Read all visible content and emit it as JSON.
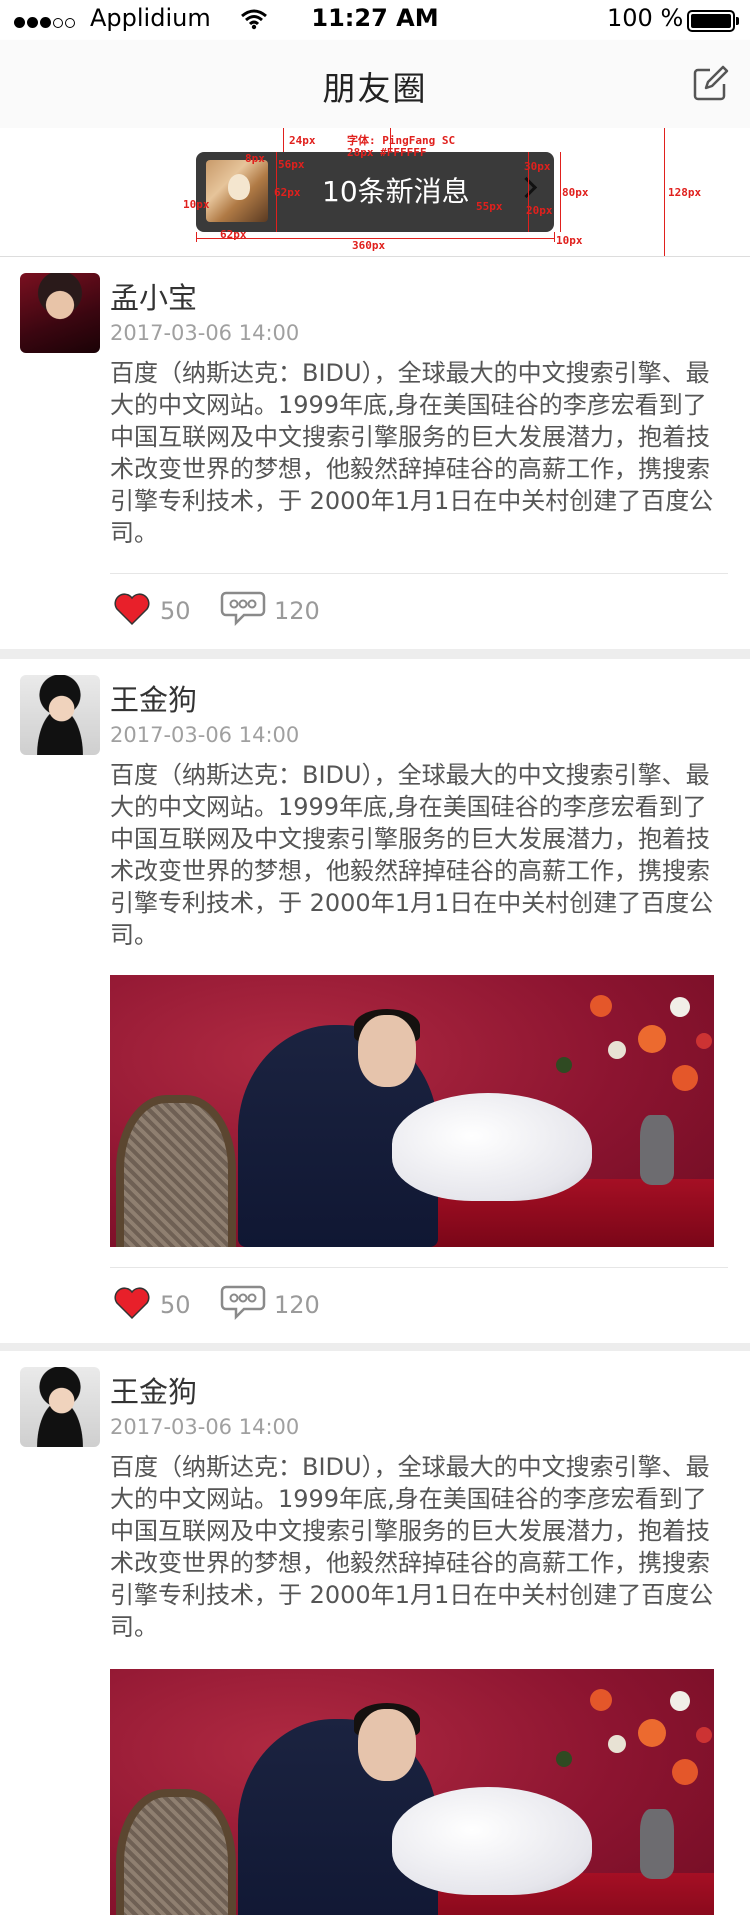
{
  "status_bar": {
    "carrier": "Applidium",
    "time": "11:27 AM",
    "battery": "100 %"
  },
  "nav": {
    "title": "朋友圈"
  },
  "notification": {
    "message": "10条新消息"
  },
  "spec_annotations": {
    "a24": "24px",
    "font": "字体: PingFang SC",
    "font2": "28px #FFFFFF",
    "a8": "8px",
    "a56": "56px",
    "a62h": "62px",
    "a10l": "10px",
    "a30": "30px",
    "a80": "80px",
    "a20": "20px",
    "a55": "55px",
    "a62w": "62px",
    "a360": "360px",
    "a10r": "10px",
    "a128": "128px"
  },
  "posts": [
    {
      "name": "孟小宝",
      "date": "2017-03-06 14:00",
      "content": "百度（纳斯达克：BIDU），全球最大的中文搜索引擎、最大的中文网站。1999年底,身在美国硅谷的李彦宏看到了中国互联网及中文搜索引擎服务的巨大发展潜力，抱着技术改变世界的梦想，他毅然辞掉硅谷的高薪工作，携搜索引擎专利技术，于 2000年1月1日在中关村创建了百度公司。",
      "likes": "50",
      "comments": "120"
    },
    {
      "name": "王金狗",
      "date": "2017-03-06 14:00",
      "content": "百度（纳斯达克：BIDU），全球最大的中文搜索引擎、最大的中文网站。1999年底,身在美国硅谷的李彦宏看到了中国互联网及中文搜索引擎服务的巨大发展潜力，抱着技术改变世界的梦想，他毅然辞掉硅谷的高薪工作，携搜索引擎专利技术，于 2000年1月1日在中关村创建了百度公司。",
      "likes": "50",
      "comments": "120"
    },
    {
      "name": "王金狗",
      "date": "2017-03-06 14:00",
      "content": "百度（纳斯达克：BIDU），全球最大的中文搜索引擎、最大的中文网站。1999年底,身在美国硅谷的李彦宏看到了中国互联网及中文搜索引擎服务的巨大发展潜力，抱着技术改变世界的梦想，他毅然辞掉硅谷的高薪工作，携搜索引擎专利技术，于 2000年1月1日在中关村创建了百度公司。"
    }
  ],
  "colors": {
    "like_heart": "#e8202a",
    "annotation": "#e0201d",
    "notification_bg": "#3a3a3a"
  },
  "icons": [
    "signal-dots-icon",
    "wifi-icon",
    "battery-icon",
    "edit-icon",
    "chevron-right-icon",
    "heart-icon",
    "comment-bubble-icon"
  ]
}
